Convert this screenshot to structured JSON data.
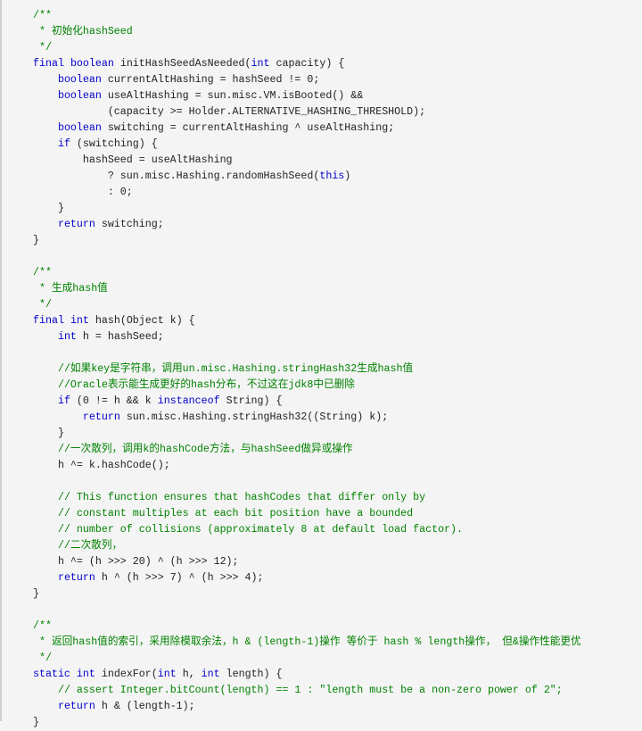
{
  "colors": {
    "background": "#f4f4f4",
    "keyword": "#0000cc",
    "comment": "#008200",
    "text": "#222222"
  },
  "code": {
    "language": "java",
    "lines": [
      [
        [
          "cm",
          "/**"
        ]
      ],
      [
        [
          "cm",
          " * 初始化hashSeed"
        ]
      ],
      [
        [
          "cm",
          " */"
        ]
      ],
      [
        [
          "kw",
          "final"
        ],
        [
          "p",
          " "
        ],
        [
          "kw",
          "boolean"
        ],
        [
          "p",
          " initHashSeedAsNeeded("
        ],
        [
          "kw",
          "int"
        ],
        [
          "p",
          " capacity) {"
        ]
      ],
      [
        [
          "p",
          "    "
        ],
        [
          "kw",
          "boolean"
        ],
        [
          "p",
          " currentAltHashing = hashSeed != 0;"
        ]
      ],
      [
        [
          "p",
          "    "
        ],
        [
          "kw",
          "boolean"
        ],
        [
          "p",
          " useAltHashing = sun.misc.VM.isBooted() &&"
        ]
      ],
      [
        [
          "p",
          "            (capacity >= Holder.ALTERNATIVE_HASHING_THRESHOLD);"
        ]
      ],
      [
        [
          "p",
          "    "
        ],
        [
          "kw",
          "boolean"
        ],
        [
          "p",
          " switching = currentAltHashing ^ useAltHashing;"
        ]
      ],
      [
        [
          "p",
          "    "
        ],
        [
          "kw",
          "if"
        ],
        [
          "p",
          " (switching) {"
        ]
      ],
      [
        [
          "p",
          "        hashSeed = useAltHashing"
        ]
      ],
      [
        [
          "p",
          "            ? sun.misc.Hashing.randomHashSeed("
        ],
        [
          "kw",
          "this"
        ],
        [
          "p",
          ")"
        ]
      ],
      [
        [
          "p",
          "            : 0;"
        ]
      ],
      [
        [
          "p",
          "    }"
        ]
      ],
      [
        [
          "p",
          "    "
        ],
        [
          "kw",
          "return"
        ],
        [
          "p",
          " switching;"
        ]
      ],
      [
        [
          "p",
          "}"
        ]
      ],
      [
        [
          "p",
          ""
        ]
      ],
      [
        [
          "cm",
          "/**"
        ]
      ],
      [
        [
          "cm",
          " * 生成hash值"
        ]
      ],
      [
        [
          "cm",
          " */"
        ]
      ],
      [
        [
          "kw",
          "final"
        ],
        [
          "p",
          " "
        ],
        [
          "kw",
          "int"
        ],
        [
          "p",
          " hash(Object k) {"
        ]
      ],
      [
        [
          "p",
          "    "
        ],
        [
          "kw",
          "int"
        ],
        [
          "p",
          " h = hashSeed;"
        ]
      ],
      [
        [
          "p",
          ""
        ]
      ],
      [
        [
          "p",
          "    "
        ],
        [
          "cm",
          "//如果key是字符串，调用un.misc.Hashing.stringHash32生成hash值"
        ]
      ],
      [
        [
          "p",
          "    "
        ],
        [
          "cm",
          "//Oracle表示能生成更好的hash分布，不过这在jdk8中已删除"
        ]
      ],
      [
        [
          "p",
          "    "
        ],
        [
          "kw",
          "if"
        ],
        [
          "p",
          " (0 != h && k "
        ],
        [
          "kw",
          "instanceof"
        ],
        [
          "p",
          " String) {"
        ]
      ],
      [
        [
          "p",
          "        "
        ],
        [
          "kw",
          "return"
        ],
        [
          "p",
          " sun.misc.Hashing.stringHash32((String) k);"
        ]
      ],
      [
        [
          "p",
          "    }"
        ]
      ],
      [
        [
          "p",
          "    "
        ],
        [
          "cm",
          "//一次散列，调用k的hashCode方法，与hashSeed做异或操作"
        ]
      ],
      [
        [
          "p",
          "    h ^= k.hashCode();"
        ]
      ],
      [
        [
          "p",
          ""
        ]
      ],
      [
        [
          "p",
          "    "
        ],
        [
          "cm",
          "// This function ensures that hashCodes that differ only by"
        ]
      ],
      [
        [
          "p",
          "    "
        ],
        [
          "cm",
          "// constant multiples at each bit position have a bounded"
        ]
      ],
      [
        [
          "p",
          "    "
        ],
        [
          "cm",
          "// number of collisions (approximately 8 at default load factor)."
        ]
      ],
      [
        [
          "p",
          "    "
        ],
        [
          "cm",
          "//二次散列，"
        ]
      ],
      [
        [
          "p",
          "    h ^= (h >>> 20) ^ (h >>> 12);"
        ]
      ],
      [
        [
          "p",
          "    "
        ],
        [
          "kw",
          "return"
        ],
        [
          "p",
          " h ^ (h >>> 7) ^ (h >>> 4);"
        ]
      ],
      [
        [
          "p",
          "}"
        ]
      ],
      [
        [
          "p",
          ""
        ]
      ],
      [
        [
          "cm",
          "/**"
        ]
      ],
      [
        [
          "cm",
          " * 返回hash值的索引，采用除模取余法，h & (length-1)操作 等价于 hash % length操作， 但&操作性能更优"
        ]
      ],
      [
        [
          "cm",
          " */"
        ]
      ],
      [
        [
          "kw",
          "static"
        ],
        [
          "p",
          " "
        ],
        [
          "kw",
          "int"
        ],
        [
          "p",
          " indexFor("
        ],
        [
          "kw",
          "int"
        ],
        [
          "p",
          " h, "
        ],
        [
          "kw",
          "int"
        ],
        [
          "p",
          " length) {"
        ]
      ],
      [
        [
          "p",
          "    "
        ],
        [
          "cm",
          "// assert Integer.bitCount(length) == 1 : \"length must be a non-zero power of 2\";"
        ]
      ],
      [
        [
          "p",
          "    "
        ],
        [
          "kw",
          "return"
        ],
        [
          "p",
          " h & (length-1);"
        ]
      ],
      [
        [
          "p",
          "}"
        ]
      ]
    ]
  }
}
